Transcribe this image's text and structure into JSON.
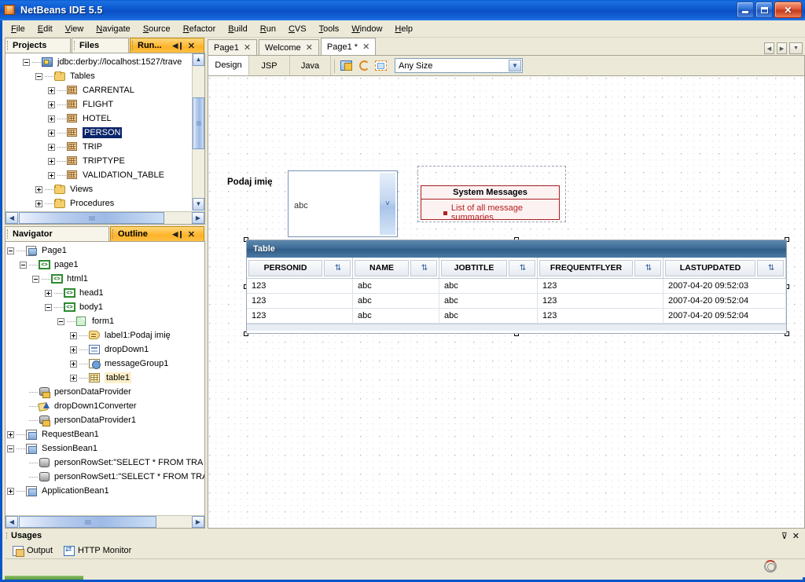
{
  "window": {
    "title": "NetBeans IDE 5.5",
    "app_icon": "netbeans-cube-icon",
    "minimize_label": "",
    "maximize_label": "",
    "close_label": "✕"
  },
  "menubar": {
    "items": [
      "File",
      "Edit",
      "View",
      "Navigate",
      "Source",
      "Refactor",
      "Build",
      "Run",
      "CVS",
      "Tools",
      "Window",
      "Help"
    ]
  },
  "left_top_panel": {
    "tabs": [
      {
        "label": "Projects",
        "active": false
      },
      {
        "label": "Files",
        "active": false
      },
      {
        "label": "Run...",
        "active": true
      }
    ],
    "controls": {
      "float": "◀❙",
      "close": "✕"
    },
    "tree": [
      {
        "depth": 1,
        "toggle": "minus",
        "icon": "database-icon",
        "label": "jdbc:derby://localhost:1527/trave",
        "state": "normal"
      },
      {
        "depth": 2,
        "toggle": "minus",
        "icon": "folder-icon",
        "label": "Tables",
        "state": "normal"
      },
      {
        "depth": 3,
        "toggle": "plus",
        "icon": "table-icon",
        "label": "CARRENTAL",
        "state": "normal"
      },
      {
        "depth": 3,
        "toggle": "plus",
        "icon": "table-icon",
        "label": "FLIGHT",
        "state": "normal"
      },
      {
        "depth": 3,
        "toggle": "plus",
        "icon": "table-icon",
        "label": "HOTEL",
        "state": "normal"
      },
      {
        "depth": 3,
        "toggle": "plus",
        "icon": "table-icon",
        "label": "PERSON",
        "state": "selected"
      },
      {
        "depth": 3,
        "toggle": "plus",
        "icon": "table-icon",
        "label": "TRIP",
        "state": "normal"
      },
      {
        "depth": 3,
        "toggle": "plus",
        "icon": "table-icon",
        "label": "TRIPTYPE",
        "state": "normal"
      },
      {
        "depth": 3,
        "toggle": "plus",
        "icon": "table-icon",
        "label": "VALIDATION_TABLE",
        "state": "normal"
      },
      {
        "depth": 2,
        "toggle": "plus",
        "icon": "folder-icon",
        "label": "Views",
        "state": "normal"
      },
      {
        "depth": 2,
        "toggle": "plus",
        "icon": "folder-icon",
        "label": "Procedures",
        "state": "normal"
      }
    ]
  },
  "left_bottom_panel": {
    "tabs": [
      {
        "label": "Navigator",
        "active": false
      },
      {
        "label": "Outline",
        "active": true
      }
    ],
    "controls": {
      "float": "◀❙",
      "close": "✕"
    },
    "tree": [
      {
        "depth": 0,
        "toggle": "minus",
        "icon": "page-icon",
        "label": "Page1",
        "state": "normal"
      },
      {
        "depth": 1,
        "toggle": "minus",
        "icon": "code-icon",
        "label": "page1",
        "state": "normal"
      },
      {
        "depth": 2,
        "toggle": "minus",
        "icon": "code-icon",
        "label": "html1",
        "state": "normal"
      },
      {
        "depth": 3,
        "toggle": "plus",
        "icon": "code-icon",
        "label": "head1",
        "state": "normal"
      },
      {
        "depth": 3,
        "toggle": "minus",
        "icon": "code-icon",
        "label": "body1",
        "state": "normal"
      },
      {
        "depth": 4,
        "toggle": "minus",
        "icon": "form-icon",
        "label": "form1",
        "state": "normal"
      },
      {
        "depth": 5,
        "toggle": "plus",
        "icon": "label-icon",
        "label": "label1:Podaj imię",
        "state": "normal"
      },
      {
        "depth": 5,
        "toggle": "plus",
        "icon": "dropdown-icon",
        "label": "dropDown1",
        "state": "normal"
      },
      {
        "depth": 5,
        "toggle": "plus",
        "icon": "message-group-icon",
        "label": "messageGroup1",
        "state": "normal"
      },
      {
        "depth": 5,
        "toggle": "plus",
        "icon": "table-component-icon",
        "label": "table1",
        "state": "softselected"
      },
      {
        "depth": 1,
        "toggle": "none",
        "icon": "data-provider-icon",
        "label": "personDataProvider",
        "state": "normal"
      },
      {
        "depth": 1,
        "toggle": "none",
        "icon": "converter-icon",
        "label": "dropDown1Converter",
        "state": "normal"
      },
      {
        "depth": 1,
        "toggle": "none",
        "icon": "data-provider-icon",
        "label": "personDataProvider1",
        "state": "normal"
      },
      {
        "depth": 0,
        "toggle": "plus",
        "icon": "bean-icon",
        "label": "RequestBean1",
        "state": "normal"
      },
      {
        "depth": 0,
        "toggle": "minus",
        "icon": "bean-icon",
        "label": "SessionBean1",
        "state": "normal"
      },
      {
        "depth": 1,
        "toggle": "none",
        "icon": "rowset-icon",
        "label": "personRowSet:\"SELECT * FROM TRA│",
        "state": "normal"
      },
      {
        "depth": 1,
        "toggle": "none",
        "icon": "rowset-icon",
        "label": "personRowSet1:\"SELECT * FROM TRA│",
        "state": "normal"
      },
      {
        "depth": 0,
        "toggle": "plus",
        "icon": "bean-icon",
        "label": "ApplicationBean1",
        "state": "normal"
      }
    ]
  },
  "editor": {
    "tabs": [
      {
        "label": "Page1",
        "close": "✕",
        "active": false
      },
      {
        "label": "Welcome",
        "close": "✕",
        "active": false
      },
      {
        "label": "Page1 *",
        "close": "✕",
        "active": true
      }
    ],
    "nav_buttons": {
      "prev": "◀",
      "next": "▶",
      "list": "▼"
    },
    "view_tabs": [
      {
        "label": "Design",
        "active": true
      },
      {
        "label": "JSP",
        "active": false
      },
      {
        "label": "Java",
        "active": false
      }
    ],
    "toolbar_icons": [
      "preview-in-browser-icon",
      "refresh-icon",
      "show-grid-icon"
    ],
    "size_combo": {
      "value": "Any Size",
      "arrow": "▼"
    }
  },
  "canvas": {
    "label1": "Podaj imię",
    "dropdown": {
      "value": "abc",
      "arrow": "˅"
    },
    "system_messages": {
      "title": "System Messages",
      "summary": "List of all message summaries"
    },
    "table": {
      "caption": "Table",
      "sort_icon": "sort-arrows-icon",
      "columns": [
        "PERSONID",
        "NAME",
        "JOBTITLE",
        "FREQUENTFLYER",
        "LASTUPDATED"
      ],
      "rows": [
        [
          "123",
          "abc",
          "abc",
          "123",
          "2007-04-20 09:52:03"
        ],
        [
          "123",
          "abc",
          "abc",
          "123",
          "2007-04-20 09:52:04"
        ],
        [
          "123",
          "abc",
          "abc",
          "123",
          "2007-04-20 09:52:04"
        ]
      ]
    }
  },
  "bottom_panel": {
    "title": "Usages",
    "controls": {
      "minimize": "⊽",
      "close": "✕"
    },
    "buttons": [
      {
        "label": "Output",
        "icon": "output-icon"
      },
      {
        "label": "HTTP Monitor",
        "icon": "http-monitor-icon"
      }
    ],
    "progress_icon": "busy-spinner-icon"
  },
  "colors": {
    "titlebar_blue": "#0a55c8",
    "panel_bg": "#ece9d8",
    "active_tab_orange": "#ffb328",
    "tree_selection": "#0a246a",
    "table_caption": "#3d6c96",
    "message_red": "#a81f22"
  }
}
